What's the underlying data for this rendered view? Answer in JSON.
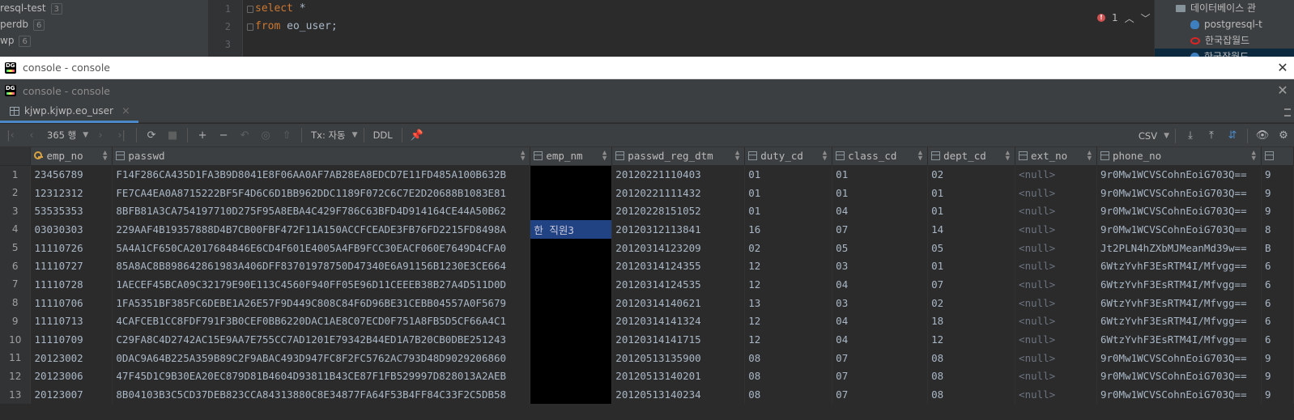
{
  "background_ide": {
    "db_tree": [
      {
        "label": "resql-test",
        "count": "3"
      },
      {
        "label": "perdb",
        "count": "6"
      },
      {
        "label": "wp",
        "count": "6"
      }
    ],
    "line_numbers": [
      "1",
      "2",
      "3"
    ],
    "code": {
      "line1_keyword": "select",
      "line1_rest": " *",
      "line2_keyword": "from",
      "line2_rest": " eo_user;"
    },
    "error_count": "1",
    "db_panel": [
      {
        "label": "데이터베이스 관",
        "icon": "folder-icon"
      },
      {
        "label": "postgresql-t",
        "icon": "postgres-icon"
      },
      {
        "label": "한국잡월드",
        "icon": "oracle-icon"
      },
      {
        "label": "한국잡월드",
        "icon": "postgres-icon"
      }
    ]
  },
  "window": {
    "outer_title": "console - console",
    "inner_title": "console - console",
    "close_glyph": "✕"
  },
  "tab": {
    "label": "kjwp.kjwp.eo_user",
    "close_glyph": "×"
  },
  "toolbar": {
    "row_count": "365 행",
    "tx_mode": "Tx: 자동",
    "ddl": "DDL",
    "export_format": "CSV"
  },
  "grid": {
    "columns": [
      "emp_no",
      "passwd",
      "emp_nm",
      "passwd_reg_dtm",
      "duty_cd",
      "class_cd",
      "dept_cd",
      "ext_no",
      "phone_no",
      ""
    ],
    "rows": [
      {
        "n": "1",
        "emp_no": "23456789",
        "passwd": "F14F286CA435D1FA3B9D8041E8F06AA0AF7AB28EA8EDCD7E11FD485A100B632B",
        "emp_nm": "",
        "passwd_reg_dtm": "20120221110403",
        "duty_cd": "01",
        "class_cd": "01",
        "dept_cd": "02",
        "ext_no": "<null>",
        "phone_no": "9r0Mw1WCVSCohnEoiG703Q==",
        "extra": "9"
      },
      {
        "n": "2",
        "emp_no": "12312312",
        "passwd": "FE7CA4EA0A8715222BF5F4D6C6D1BB962DDC1189F072C6C7E2D20688B1083E81",
        "emp_nm": "",
        "passwd_reg_dtm": "20120221111432",
        "duty_cd": "01",
        "class_cd": "01",
        "dept_cd": "01",
        "ext_no": "<null>",
        "phone_no": "9r0Mw1WCVSCohnEoiG703Q==",
        "extra": "9"
      },
      {
        "n": "3",
        "emp_no": "53535353",
        "passwd": "8BFB81A3CA754197710D275F95A8EBA4C429F786C63BFD4D914164CE44A50B62",
        "emp_nm": "",
        "passwd_reg_dtm": "20120228151052",
        "duty_cd": "01",
        "class_cd": "04",
        "dept_cd": "01",
        "ext_no": "<null>",
        "phone_no": "9r0Mw1WCVSCohnEoiG703Q==",
        "extra": "9"
      },
      {
        "n": "4",
        "emp_no": "03030303",
        "passwd": "229AAF4B19357888D4B7CB00FBF472F11A150ACCFCEADE3FB76FD2215FD8498A",
        "emp_nm": "한 직원3",
        "passwd_reg_dtm": "20120312113841",
        "duty_cd": "16",
        "class_cd": "07",
        "dept_cd": "14",
        "ext_no": "<null>",
        "phone_no": "9r0Mw1WCVSCohnEoiG703Q==",
        "extra": "8"
      },
      {
        "n": "5",
        "emp_no": "11110726",
        "passwd": "5A4A1CF650CA2017684846E6CD4F601E4005A4FB9FCC30EACF060E7649D4CFA0",
        "emp_nm": "",
        "passwd_reg_dtm": "20120314123209",
        "duty_cd": "02",
        "class_cd": "05",
        "dept_cd": "05",
        "ext_no": "<null>",
        "phone_no": "Jt2PLN4hZXbMJMeanMd39w==",
        "extra": "B"
      },
      {
        "n": "6",
        "emp_no": "11110727",
        "passwd": "85A8AC8B898642861983A406DFF83701978750D47340E6A91156B1230E3CE664",
        "emp_nm": "",
        "passwd_reg_dtm": "20120314124355",
        "duty_cd": "12",
        "class_cd": "03",
        "dept_cd": "01",
        "ext_no": "<null>",
        "phone_no": "6WtzYvhF3EsRTM4I/Mfvgg==",
        "extra": "6"
      },
      {
        "n": "7",
        "emp_no": "11110728",
        "passwd": "1AECEF45BCA09C32179E90E113C4560F940FF05E96D11CEEEB38B27A4D511D0D",
        "emp_nm": "",
        "passwd_reg_dtm": "20120314124535",
        "duty_cd": "12",
        "class_cd": "04",
        "dept_cd": "07",
        "ext_no": "<null>",
        "phone_no": "6WtzYvhF3EsRTM4I/Mfvgg==",
        "extra": "6"
      },
      {
        "n": "8",
        "emp_no": "11110706",
        "passwd": "1FA5351BF385FC6DEBE1A26E57F9D449C808C84F6D96BE31CEBB04557A0F5679",
        "emp_nm": "",
        "passwd_reg_dtm": "20120314140621",
        "duty_cd": "13",
        "class_cd": "03",
        "dept_cd": "02",
        "ext_no": "<null>",
        "phone_no": "6WtzYvhF3EsRTM4I/Mfvgg==",
        "extra": "6"
      },
      {
        "n": "9",
        "emp_no": "11110713",
        "passwd": "4CAFCEB1CC8FDF791F3B0CEF0BB6220DAC1AE8C07ECD0F751A8FB5D5CF66A4C1",
        "emp_nm": "",
        "passwd_reg_dtm": "20120314141324",
        "duty_cd": "12",
        "class_cd": "04",
        "dept_cd": "18",
        "ext_no": "<null>",
        "phone_no": "6WtzYvhF3EsRTM4I/Mfvgg==",
        "extra": "6"
      },
      {
        "n": "10",
        "emp_no": "11110709",
        "passwd": "C29FA8C4D2742AC15E9AA7E755CC7AD1201E79342B44ED1A7B20CB0DBE251243",
        "emp_nm": "",
        "passwd_reg_dtm": "20120314141715",
        "duty_cd": "12",
        "class_cd": "04",
        "dept_cd": "12",
        "ext_no": "<null>",
        "phone_no": "6WtzYvhF3EsRTM4I/Mfvgg==",
        "extra": "6"
      },
      {
        "n": "11",
        "emp_no": "20123002",
        "passwd": "0DAC9A64B225A359B89C2F9ABAC493D947FC8F2FC5762AC793D48D9029206860",
        "emp_nm": "",
        "passwd_reg_dtm": "20120513135900",
        "duty_cd": "08",
        "class_cd": "07",
        "dept_cd": "08",
        "ext_no": "<null>",
        "phone_no": "9r0Mw1WCVSCohnEoiG703Q==",
        "extra": "9"
      },
      {
        "n": "12",
        "emp_no": "20123006",
        "passwd": "47F45D1C9B30EA20EC879D81B4604D93811B43CE87F1FB529997D828013A2AEB",
        "emp_nm": "",
        "passwd_reg_dtm": "20120513140201",
        "duty_cd": "08",
        "class_cd": "07",
        "dept_cd": "08",
        "ext_no": "<null>",
        "phone_no": "9r0Mw1WCVSCohnEoiG703Q==",
        "extra": "9"
      },
      {
        "n": "13",
        "emp_no": "20123007",
        "passwd": "8B04103B3C5CD37DEB823CCA84313880C8E34877FA64F53B4FF84C33F2C5DB58",
        "emp_nm": "",
        "passwd_reg_dtm": "20120513140234",
        "duty_cd": "08",
        "class_cd": "07",
        "dept_cd": "08",
        "ext_no": "<null>",
        "phone_no": "9r0Mw1WCVSCohnEoiG703Q==",
        "extra": "9"
      }
    ]
  }
}
